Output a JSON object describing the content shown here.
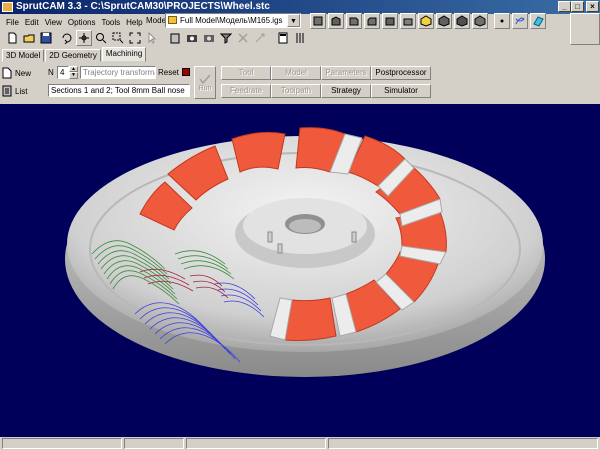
{
  "window": {
    "title": "SprutCAM 3.3 - C:\\SprutCAM30\\PROJECTS\\Wheel.stc",
    "min": "_",
    "max": "□",
    "close": "×"
  },
  "menu": [
    {
      "label": "File"
    },
    {
      "label": "Edit"
    },
    {
      "label": "View"
    },
    {
      "label": "Options"
    },
    {
      "label": "Tools"
    },
    {
      "label": "Help"
    }
  ],
  "model": {
    "label": "Model",
    "value": "Full Model\\Модель\\M165.igs"
  },
  "tabs": [
    {
      "label": "3D Model",
      "active": false
    },
    {
      "label": "2D Geometry",
      "active": false
    },
    {
      "label": "Machining",
      "active": true
    }
  ],
  "operation": {
    "new_label": "New",
    "list_label": "List",
    "n_label": "N",
    "n_value": "4",
    "operation_name": "Trajectory transformatio",
    "reset_label": "Reset",
    "description": "Sections 1 and 2; Tool 8mm Ball nose",
    "run_label": "Run"
  },
  "parameter_buttons": [
    {
      "label": "Tool",
      "enabled": false
    },
    {
      "label": "Model",
      "enabled": false
    },
    {
      "label": "Parameters",
      "enabled": false
    },
    {
      "label": "Postprocessor",
      "enabled": true
    },
    {
      "label": "Feedrate",
      "enabled": false
    },
    {
      "label": "Toolpath",
      "enabled": false
    },
    {
      "label": "Strategy",
      "enabled": true
    },
    {
      "label": "Simulator",
      "enabled": true
    }
  ],
  "colors": {
    "viewport_bg": "#00005a",
    "part_body": "#d8d8d8",
    "blade": "#f05a3c",
    "toolpath_green": "#3c8c3c",
    "toolpath_blue": "#3c3cdc",
    "toolpath_red": "#a01e3c"
  }
}
